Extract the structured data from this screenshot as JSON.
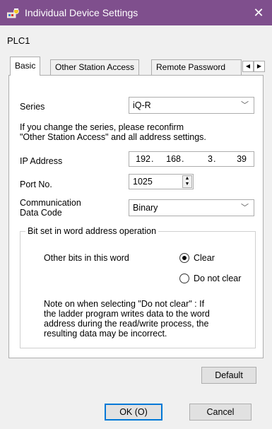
{
  "window": {
    "title": "Individual Device Settings",
    "close_glyph": "✕",
    "icon": "device-settings-icon",
    "titlebar_color": "#7f4f8d"
  },
  "device": {
    "name": "PLC1"
  },
  "tabs": [
    {
      "label": "Basic",
      "active": true
    },
    {
      "label": "Other Station Access",
      "active": false
    },
    {
      "label": "Remote Password",
      "active": false
    }
  ],
  "tab_scroll": {
    "left": "◀",
    "right": "▶"
  },
  "basic": {
    "series_label": "Series",
    "series_value": "iQ-R",
    "series_note_line1": "If you change the series, please reconfirm",
    "series_note_line2": "\"Other Station Access\" and all address settings.",
    "ip_label": "IP Address",
    "ip": [
      "192",
      "168",
      "3",
      "39"
    ],
    "port_label": "Port No.",
    "port_value": "1025",
    "code_label_line1": "Communication",
    "code_label_line2": "Data Code",
    "code_value": "Binary",
    "group_title": "Bit set in word address operation",
    "other_bits_label": "Other bits in this word",
    "option_clear": "Clear",
    "option_not_clear": "Do not clear",
    "selected_option": "Clear",
    "note_lines": [
      "Note on when selecting \"Do not clear\" : If",
      "the ladder program writes data to the word",
      "address during the read/write process, the",
      "resulting data may be incorrect."
    ]
  },
  "buttons": {
    "default": "Default",
    "ok": "OK (O)",
    "cancel": "Cancel"
  }
}
